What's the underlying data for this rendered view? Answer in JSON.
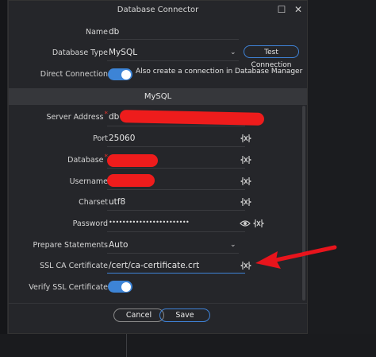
{
  "window": {
    "title": "Database Connector",
    "maximize_glyph": "☐",
    "close_glyph": "✕"
  },
  "form": {
    "name_label": "Name",
    "name_value": "db",
    "db_type_label": "Database Type",
    "db_type_value": "MySQL",
    "test_connection": "Test Connection",
    "direct_label": "Direct Connection",
    "direct_desc": "Also create a connection in Database Manager",
    "direct_on": true
  },
  "mysql": {
    "section_title": "MySQL",
    "server_label": "Server Address",
    "server_value_prefix": "db",
    "port_label": "Port",
    "port_value": "25060",
    "database_label": "Database",
    "username_label": "Username",
    "charset_label": "Charset",
    "charset_value": "utf8",
    "password_label": "Password",
    "password_value": "••••••••••••••••••••••••",
    "prepare_label": "Prepare Statements",
    "prepare_value": "Auto",
    "ssl_label": "SSL CA Certificate",
    "ssl_value": "/cert/ca-certificate.crt",
    "verify_label": "Verify SSL Certificate",
    "verify_on": true,
    "required_mark": "*"
  },
  "footer": {
    "cancel": "Cancel",
    "save": "Save"
  },
  "colors": {
    "accent": "#3f83d8",
    "redaction": "#ee1c1c",
    "annotation_arrow": "#e8141c"
  },
  "icons": [
    "variable-icon",
    "eye-icon",
    "chevron-down-icon",
    "arrow-annotation"
  ]
}
